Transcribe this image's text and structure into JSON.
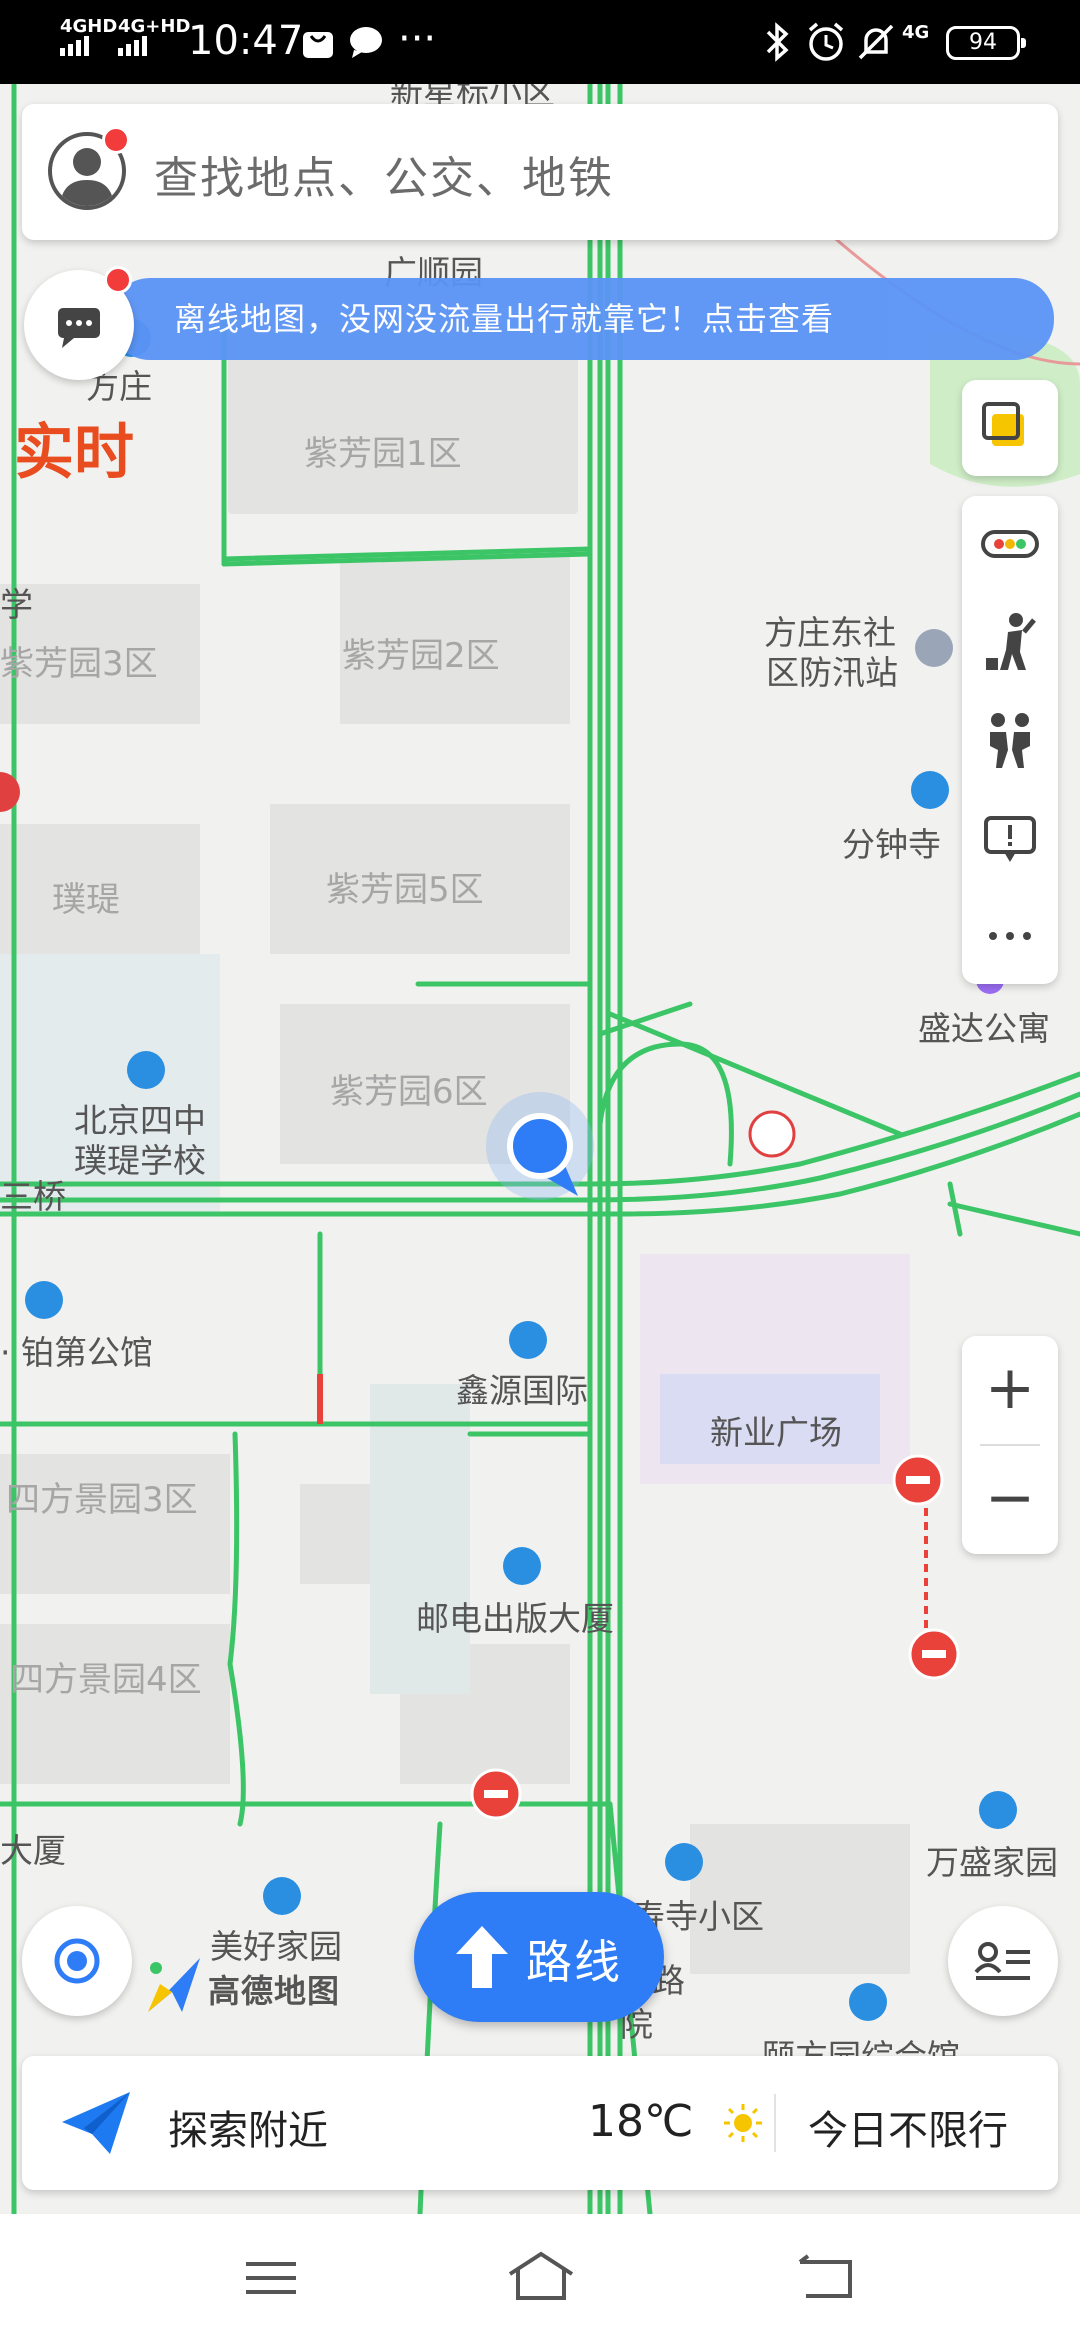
{
  "status_bar": {
    "signal1": "4GHD",
    "signal2": "4G+HD",
    "time": "10:47",
    "signal3": "4G",
    "battery": "94"
  },
  "search": {
    "placeholder": "查找地点、公交、地铁"
  },
  "banner": {
    "text": "离线地图，没网没流量出行就靠它！点击查看"
  },
  "map": {
    "labels": {
      "xinshengbiao": "新星标小区",
      "guangshunyuan": "广顺园",
      "fangzhuang": "方庄",
      "shi": "实时",
      "zifang1": "紫芳园1区",
      "xue": "学",
      "zifang3": "紫芳园3区",
      "zifang2": "紫芳园2区",
      "fangzhuang_dongshe_1": "方庄东社",
      "fangzhuang_dongshe_2": "区防汛站",
      "fenzhongsi": "分钟寺",
      "puti": "璞瑅",
      "zifang5": "紫芳园5区",
      "shengda": "盛达公寓",
      "zifang6": "紫芳园6区",
      "school_1": "北京四中",
      "school_2": "璞瑅学校",
      "qiao": "三桥",
      "bodi": "· 铂第公馆",
      "xinyuan": "鑫源国际",
      "xinye": "新业广场",
      "sifang3": "四方景园3区",
      "youdian": "邮电出版大厦",
      "sifang4": "四方景园4区",
      "dasha": "大厦",
      "wansheng": "万盛家园",
      "meihao": "美好家园",
      "shousi": "寿寺小区",
      "lu": "路",
      "yuan": "院",
      "ying": "颐方园综合馆"
    }
  },
  "logo": "高德地图",
  "route_button": {
    "label": "路线"
  },
  "explore": {
    "label": "探索附近",
    "temperature": "18℃",
    "restriction": "今日不限行"
  },
  "colors": {
    "road": "#3cc566",
    "road_red": "#e8423b",
    "accent_blue": "#2f7df6",
    "banner": "#5b94f6",
    "poi_blue": "#2a8fe0"
  },
  "icons": {
    "layers": "layers-icon",
    "traffic": "traffic-light-icon",
    "pedestrian": "pedestrian-icon",
    "companion": "companion-icon",
    "feedback": "feedback-icon",
    "more": "more-icon"
  }
}
